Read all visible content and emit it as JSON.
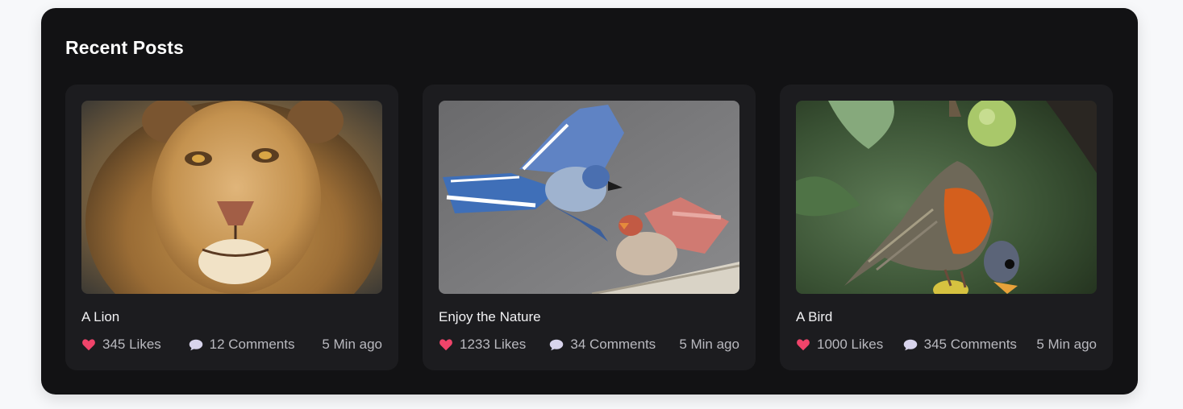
{
  "section": {
    "title": "Recent Posts"
  },
  "posts": [
    {
      "title": "A Lion",
      "likes": "345 Likes",
      "comments": "12 Comments",
      "time": "5 Min ago",
      "image_icon": "lion-photo"
    },
    {
      "title": "Enjoy the Nature",
      "likes": "1233 Likes",
      "comments": "34 Comments",
      "time": "5 Min ago",
      "image_icon": "blue-jay-and-cardinal-photo"
    },
    {
      "title": "A Bird",
      "likes": "1000 Likes",
      "comments": "345 Comments",
      "time": "5 Min ago",
      "image_icon": "robin-photo"
    }
  ],
  "icons": {
    "like": "heart-icon",
    "comment": "speech-bubble-icon"
  },
  "colors": {
    "panel_bg": "#121214",
    "card_bg": "#1c1c1f",
    "heart": "#f0446a",
    "text_primary": "#f1f1f3",
    "text_secondary": "#b9b9bf"
  }
}
